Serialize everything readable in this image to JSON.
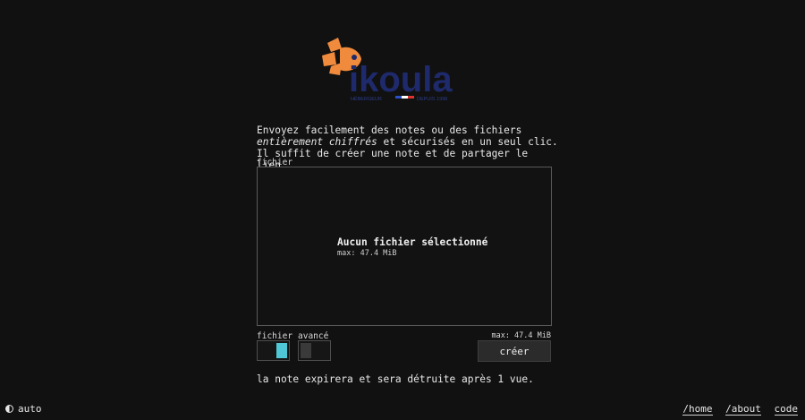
{
  "brand": {
    "name": "ikoula",
    "tagline_left": "HÉBERGEUR",
    "tagline_right": "DEPUIS 1998",
    "colors": {
      "orange": "#f08a3c",
      "navy": "#1e2a6b",
      "blue": "#2b50c8",
      "red": "#e03131"
    }
  },
  "intro": {
    "text_1": "Envoyez facilement des notes ou des fichiers",
    "text_emphasis": "entièrement chiffrés",
    "text_2": " et sécurisés en un seul clic. Il suffit de créer une note et de partager le lien."
  },
  "file_field": {
    "label": "fichier",
    "dropzone_title": "Aucun fichier sélectionné",
    "dropzone_max": "max: 47.4 MiB"
  },
  "mode_toggles": [
    {
      "label": "fichier",
      "active": true,
      "color": "#4fc7d6"
    },
    {
      "label": "avancé",
      "active": false,
      "color": "#3a3a3a"
    }
  ],
  "submit": {
    "max_label": "max: 47.4 MiB",
    "button_label": "créer"
  },
  "expiry_text": "la note expirera et sera détruite après 1 vue.",
  "footer": {
    "theme_label": "auto",
    "links": [
      "/home",
      "/about",
      "code"
    ]
  }
}
